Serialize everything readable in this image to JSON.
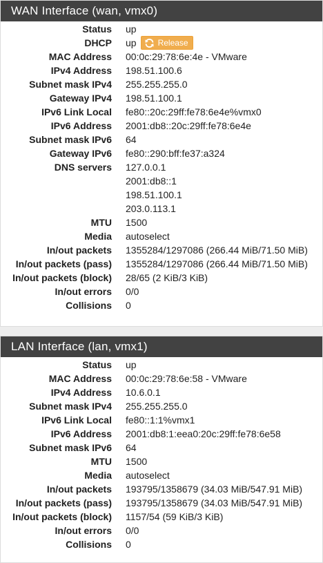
{
  "wan": {
    "title": "WAN Interface (wan, vmx0)",
    "status": {
      "label": "Status",
      "value": "up"
    },
    "dhcp": {
      "label": "DHCP",
      "value": "up",
      "button_label": "Release",
      "button_icon": "refresh-icon",
      "button_color": "#f0ad4e"
    },
    "mac": {
      "label": "MAC Address",
      "value": "00:0c:29:78:6e:4e - VMware"
    },
    "ipv4": {
      "label": "IPv4 Address",
      "value": "198.51.100.6"
    },
    "subnet4": {
      "label": "Subnet mask IPv4",
      "value": "255.255.255.0"
    },
    "gateway4": {
      "label": "Gateway IPv4",
      "value": "198.51.100.1"
    },
    "ipv6_link_local": {
      "label": "IPv6 Link Local",
      "value": "fe80::20c:29ff:fe78:6e4e%vmx0"
    },
    "ipv6": {
      "label": "IPv6 Address",
      "value": "2001:db8::20c:29ff:fe78:6e4e"
    },
    "subnet6": {
      "label": "Subnet mask IPv6",
      "value": "64"
    },
    "gateway6": {
      "label": "Gateway IPv6",
      "value": "fe80::290:bff:fe37:a324"
    },
    "dns": {
      "label": "DNS servers",
      "values": [
        "127.0.0.1",
        "2001:db8::1",
        "198.51.100.1",
        "203.0.113.1"
      ]
    },
    "mtu": {
      "label": "MTU",
      "value": "1500"
    },
    "media": {
      "label": "Media",
      "value": "autoselect"
    },
    "packets": {
      "label": "In/out packets",
      "value": "1355284/1297086 (266.44 MiB/71.50 MiB)"
    },
    "packets_pass": {
      "label": "In/out packets (pass)",
      "value": "1355284/1297086 (266.44 MiB/71.50 MiB)"
    },
    "packets_block": {
      "label": "In/out packets (block)",
      "value": "28/65 (2 KiB/3 KiB)"
    },
    "errors": {
      "label": "In/out errors",
      "value": "0/0"
    },
    "collisions": {
      "label": "Collisions",
      "value": "0"
    }
  },
  "lan": {
    "title": "LAN Interface (lan, vmx1)",
    "status": {
      "label": "Status",
      "value": "up"
    },
    "mac": {
      "label": "MAC Address",
      "value": "00:0c:29:78:6e:58 - VMware"
    },
    "ipv4": {
      "label": "IPv4 Address",
      "value": "10.6.0.1"
    },
    "subnet4": {
      "label": "Subnet mask IPv4",
      "value": "255.255.255.0"
    },
    "ipv6_link_local": {
      "label": "IPv6 Link Local",
      "value": "fe80::1:1%vmx1"
    },
    "ipv6": {
      "label": "IPv6 Address",
      "value": "2001:db8:1:eea0:20c:29ff:fe78:6e58"
    },
    "subnet6": {
      "label": "Subnet mask IPv6",
      "value": "64"
    },
    "mtu": {
      "label": "MTU",
      "value": "1500"
    },
    "media": {
      "label": "Media",
      "value": "autoselect"
    },
    "packets": {
      "label": "In/out packets",
      "value": "193795/1358679 (34.03 MiB/547.91 MiB)"
    },
    "packets_pass": {
      "label": "In/out packets (pass)",
      "value": "193795/1358679 (34.03 MiB/547.91 MiB)"
    },
    "packets_block": {
      "label": "In/out packets (block)",
      "value": "1157/54 (59 KiB/3 KiB)"
    },
    "errors": {
      "label": "In/out errors",
      "value": "0/0"
    },
    "collisions": {
      "label": "Collisions",
      "value": "0"
    }
  }
}
